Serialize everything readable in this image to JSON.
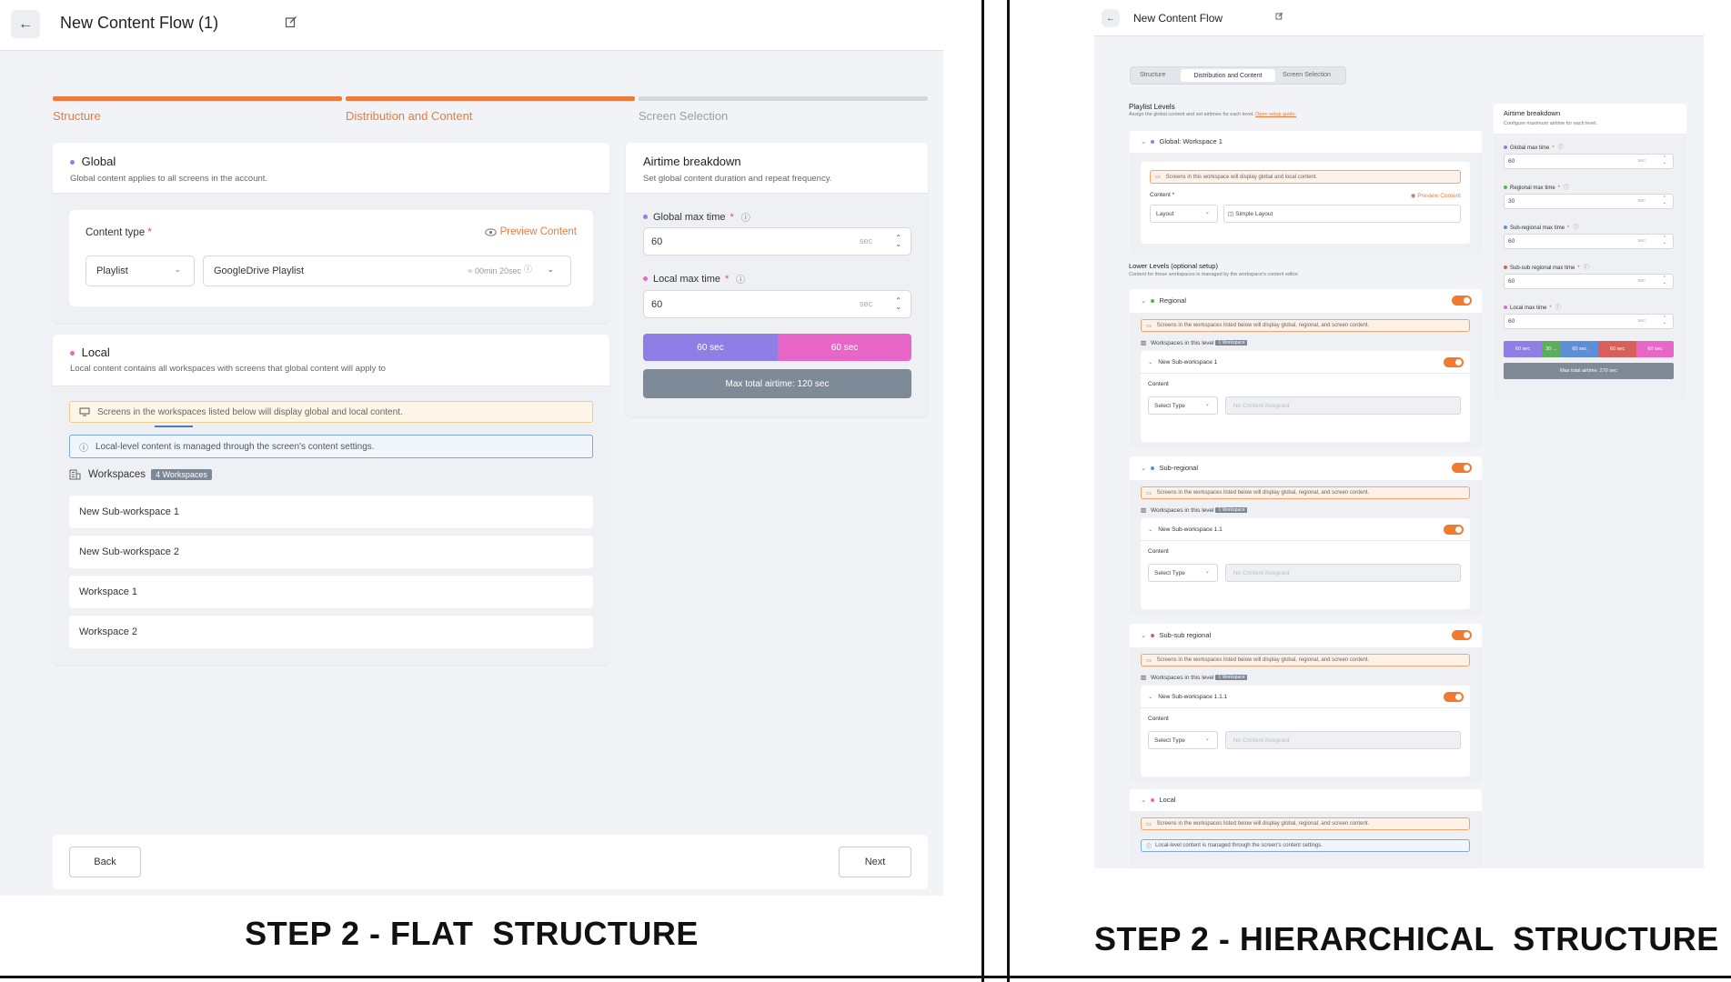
{
  "flat": {
    "title": "New Content Flow (1)",
    "steps": [
      {
        "label": "Structure",
        "state": "done"
      },
      {
        "label": "Distribution and Content",
        "state": "active"
      },
      {
        "label": "Screen Selection",
        "state": "pending"
      }
    ],
    "global": {
      "title": "Global",
      "subtitle": "Global content applies to all screens in the account.",
      "content_type_label": "Content type",
      "required_mark": "*",
      "preview_label": "Preview Content",
      "type_value": "Playlist",
      "playlist_value": "GoogleDrive Playlist",
      "duration": "≈ 00min 20sec"
    },
    "local": {
      "title": "Local",
      "subtitle": "Local content contains all workspaces with screens that global content will apply to",
      "warning": "Screens in the workspaces listed below will display global and local content.",
      "info": "Local-level content is managed through the screen's content settings.",
      "workspaces_label": "Workspaces",
      "workspaces_badge": "4 Workspaces",
      "workspaces": [
        "New Sub-workspace 1",
        "New Sub-workspace 2",
        "Workspace 1",
        "Workspace 2"
      ]
    },
    "airtime": {
      "title": "Airtime breakdown",
      "subtitle": "Set global content duration and repeat frequency.",
      "global_label": "Global max time",
      "global_value": "60",
      "local_label": "Local max time",
      "local_value": "60",
      "unit": "sec",
      "seg_global": "60 sec",
      "seg_local": "60 sec",
      "total": "Max total airtime: 120 sec"
    },
    "back_label": "Back",
    "next_label": "Next",
    "caption": "STEP 2 - FLAT  STRUCTURE"
  },
  "hier": {
    "title": "New Content Flow",
    "tabs": [
      "Structure",
      "Distribution and Content",
      "Screen Selection"
    ],
    "playlist_levels_title": "Playlist Levels",
    "playlist_levels_sub": "Assign the global content and set airtimes for each level.",
    "setup_link": "Open setup guide.",
    "global_header": "Global: Workspace 1",
    "global_warning": "Screens in this workspace will display global and local content.",
    "content_label": "Content *",
    "preview_label": "Preview Content",
    "global_type": "Layout",
    "global_value": "Simple Layout",
    "lower_title": "Lower Levels (optional setup)",
    "lower_sub": "Content for these workspaces is managed by the workspace's content editor.",
    "levels": [
      {
        "name": "Regional",
        "warning": "Screens in the workspaces listed below will display global, regional, and screen content.",
        "ws_label": "Workspaces in this level",
        "badge": "1 Workspace",
        "sub": "New Sub-workspace 1",
        "content": "Content",
        "select": "Select Type",
        "placeholder": "No Content Assigned"
      },
      {
        "name": "Sub-regional",
        "warning": "Screens in the workspaces listed below will display global, regional, and screen content.",
        "ws_label": "Workspaces in this level",
        "badge": "1 Workspace",
        "sub": "New Sub-workspace 1.1",
        "content": "Content",
        "select": "Select Type",
        "placeholder": "No Content Assigned"
      },
      {
        "name": "Sub-sub regional",
        "warning": "Screens in the workspaces listed below will display global, regional, and screen content.",
        "ws_label": "Workspaces in this level",
        "badge": "1 Workspace",
        "sub": "New Sub-workspace 1.1.1",
        "content": "Content",
        "select": "Select Type",
        "placeholder": "No Content Assigned"
      }
    ],
    "local_name": "Local",
    "local_warning": "Screens in the workspaces listed below will display global, regional, and screen content.",
    "local_info": "Local-level content is managed through the screen's content settings.",
    "airtime": {
      "title": "Airtime breakdown",
      "subtitle": "Configure maximum airtime for each level.",
      "fields": [
        {
          "label": "Global max time",
          "value": "60",
          "color": "#8f7ee6"
        },
        {
          "label": "Regional max time",
          "value": "30",
          "color": "#5cae5c"
        },
        {
          "label": "Sub-regional max time",
          "value": "60",
          "color": "#5d8fd6"
        },
        {
          "label": "Sub-sub regional max time",
          "value": "60",
          "color": "#d9605a"
        },
        {
          "label": "Local max time",
          "value": "60",
          "color": "#e866c8"
        }
      ],
      "unit": "sec",
      "segments": [
        "60 sec",
        "30 ...",
        "60 sec",
        "60 sec",
        "60 sec"
      ],
      "total": "Max total airtime: 270 sec"
    },
    "caption": "STEP 2 - HIERARCHICAL  STRUCTURE"
  },
  "colors": {
    "accent": "#ee7a3c",
    "global_purple": "#8f7ee6",
    "local_pink": "#e866c8",
    "total_gray": "#7f8a99"
  }
}
